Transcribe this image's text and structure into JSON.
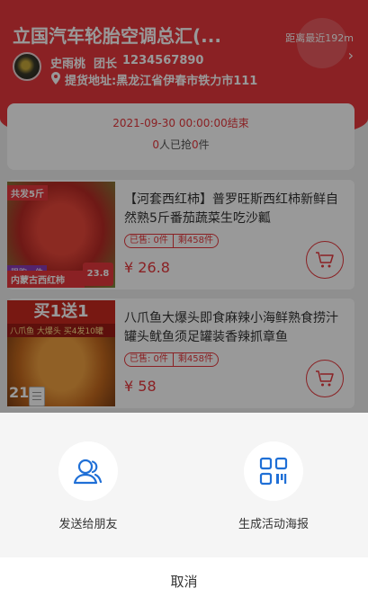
{
  "header": {
    "store_name": "立国汽车轮胎空调总汇(...",
    "distance": "距离最近192m",
    "leader_name": "史雨桃",
    "leader_role": "团长",
    "leader_phone": "1234567890",
    "address": "提货地址:黑龙江省伊春市铁力市111"
  },
  "activity": {
    "end_time": "2021-09-30 00:00:00结束",
    "joined_count": "0",
    "joined_text": "人已抢",
    "item_count": "0",
    "item_unit": "件"
  },
  "products": [
    {
      "title": "【河套西红柿】普罗旺斯西红柿新鲜自然熟5斤番茄蔬菜生吃沙瓤",
      "sold": "已售: 0件",
      "remaining": "剩458件",
      "price": "¥ 26.8",
      "image": {
        "tag_top": "共发5斤",
        "tag_limit": "限购一件",
        "tag_origin": "内蒙古西红柿",
        "price_badge": "23.8"
      }
    },
    {
      "title": "八爪鱼大爆头即食麻辣小海鲜熟食捞汁罐头鱿鱼须足罐装香辣抓章鱼",
      "sold": "已售: 0件",
      "remaining": "剩458件",
      "price": "¥ 58",
      "image": {
        "big_title": "买1送1",
        "sub_title": "八爪鱼 大爆头  买4发10罐",
        "day_badge": "21"
      }
    }
  ],
  "share_sheet": {
    "send_to_friend": "发送给朋友",
    "generate_poster": "生成活动海报",
    "cancel": "取消"
  },
  "colors": {
    "accent": "#e6373c",
    "share_icon": "#1f6fd6"
  }
}
